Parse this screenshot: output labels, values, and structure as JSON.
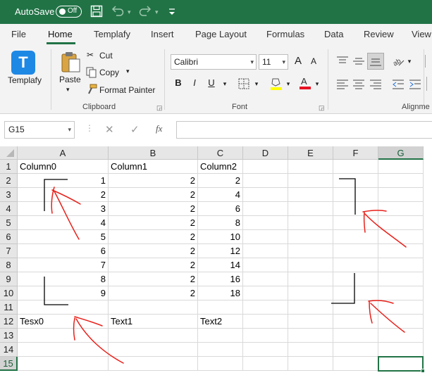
{
  "titlebar": {
    "autosave_label": "AutoSave",
    "toggle_state": "Off"
  },
  "tabs": [
    "File",
    "Home",
    "Templafy",
    "Insert",
    "Page Layout",
    "Formulas",
    "Data",
    "Review",
    "View"
  ],
  "ribbon": {
    "templafy_label": "Templafy",
    "paste_label": "Paste",
    "cut_label": "Cut",
    "copy_label": "Copy",
    "format_painter_label": "Format Painter",
    "clipboard_group": "Clipboard",
    "font_name": "Calibri",
    "font_size": "11",
    "font_group": "Font",
    "bold": "B",
    "italic": "I",
    "underline": "U",
    "grow_font": "A",
    "shrink_font": "A",
    "alignment_group": "Alignme"
  },
  "formula_bar": {
    "name_box": "G15",
    "cancel_symbol": "✕",
    "enter_symbol": "✓",
    "fx_label": "fx",
    "formula": ""
  },
  "sheet": {
    "columns": [
      "A",
      "B",
      "C",
      "D",
      "E",
      "F",
      "G"
    ],
    "rows": [
      "1",
      "2",
      "3",
      "4",
      "5",
      "6",
      "7",
      "8",
      "9",
      "10",
      "11",
      "12",
      "13",
      "14",
      "15"
    ],
    "selected_cell": "G15",
    "cells": {
      "A1": "Column0",
      "B1": "Column1",
      "C1": "Column2",
      "A2": "1",
      "B2": "2",
      "C2": "2",
      "A3": "2",
      "B3": "2",
      "C3": "4",
      "A4": "3",
      "B4": "2",
      "C4": "6",
      "A5": "4",
      "B5": "2",
      "C5": "8",
      "A6": "5",
      "B6": "2",
      "C6": "10",
      "A7": "6",
      "B7": "2",
      "C7": "12",
      "A8": "7",
      "B8": "2",
      "C8": "14",
      "A9": "8",
      "B9": "2",
      "C9": "16",
      "A10": "9",
      "B10": "2",
      "C10": "18",
      "A12": "Tesx0",
      "B12": "Text1",
      "C12": "Text2"
    }
  },
  "colors": {
    "excel_green": "#217346",
    "annotation_red": "#e8201a",
    "bracket_black": "#000000"
  }
}
